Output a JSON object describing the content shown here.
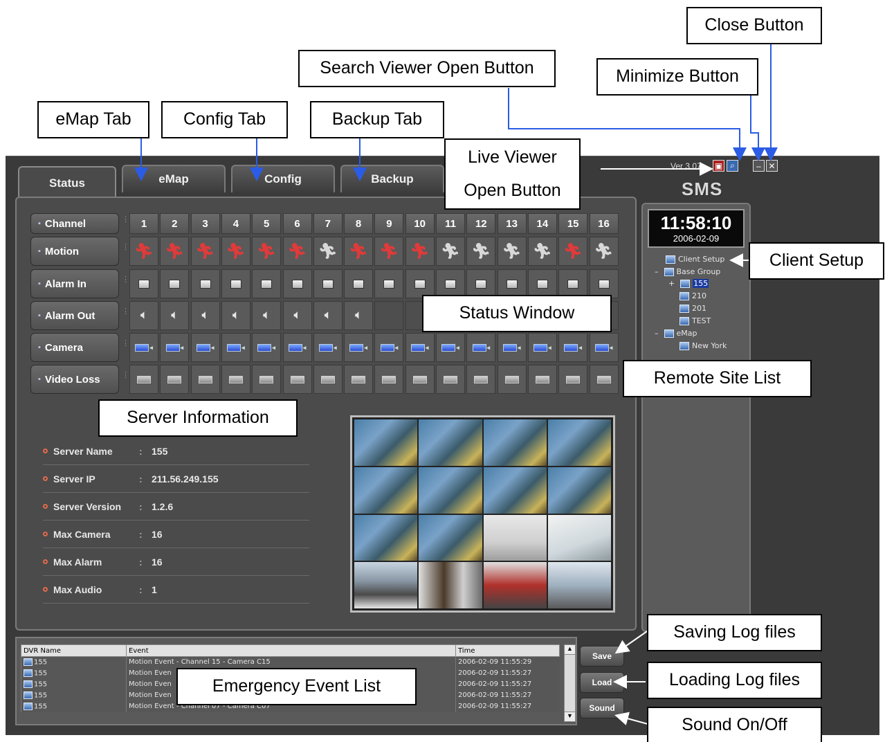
{
  "app": {
    "version": "Ver 3.07",
    "brand": "SMS",
    "clock_time": "11:58:10",
    "clock_date": "2006-02-09"
  },
  "tabs": [
    "Status",
    "eMap",
    "Config",
    "Backup"
  ],
  "status_grid": {
    "row_labels": [
      "Channel",
      "Motion",
      "Alarm In",
      "Alarm Out",
      "Camera",
      "Video Loss"
    ],
    "channels": [
      "1",
      "2",
      "3",
      "4",
      "5",
      "6",
      "7",
      "8",
      "9",
      "10",
      "11",
      "12",
      "13",
      "14",
      "15",
      "16"
    ],
    "motion_active": [
      true,
      true,
      true,
      true,
      true,
      true,
      false,
      true,
      true,
      true,
      false,
      false,
      false,
      false,
      true,
      false
    ],
    "alarm_out_count": 8
  },
  "server_info": [
    {
      "label": "Server Name",
      "value": "155"
    },
    {
      "label": "Server IP",
      "value": "211.56.249.155"
    },
    {
      "label": "Server Version",
      "value": "1.2.6"
    },
    {
      "label": "Max Camera",
      "value": "16"
    },
    {
      "label": "Max Alarm",
      "value": "16"
    },
    {
      "label": "Max Audio",
      "value": "1"
    }
  ],
  "tree": {
    "client_setup": "Client Setup",
    "base_group": "Base Group",
    "sites": [
      "155",
      "210",
      "201",
      "TEST"
    ],
    "emap": "eMap",
    "emap_child": "New York"
  },
  "event_list": {
    "headers": [
      "DVR Name",
      "Event",
      "Time"
    ],
    "rows": [
      {
        "dvr": "155",
        "event": "Motion Event  -  Channel 15  -  Camera C15",
        "time": "2006-02-09 11:55:29"
      },
      {
        "dvr": "155",
        "event": "Motion Even",
        "time": "2006-02-09 11:55:27"
      },
      {
        "dvr": "155",
        "event": "Motion Even",
        "time": "2006-02-09 11:55:27"
      },
      {
        "dvr": "155",
        "event": "Motion Even",
        "time": "2006-02-09 11:55:27"
      },
      {
        "dvr": "155",
        "event": "Motion Event  -  Channel 07  -  Camera C07",
        "time": "2006-02-09 11:55:27"
      }
    ]
  },
  "side_buttons": {
    "save": "Save",
    "load": "Load",
    "sound": "Sound"
  },
  "callouts": {
    "close": "Close Button",
    "search_viewer": "Search Viewer Open Button",
    "minimize": "Minimize Button",
    "emap_tab": "eMap Tab",
    "config_tab": "Config Tab",
    "backup_tab": "Backup Tab",
    "live_viewer_1": "Live Viewer",
    "live_viewer_2": "Open Button",
    "client_setup": "Client Setup",
    "status_window": "Status Window",
    "remote_site_list": "Remote Site List",
    "server_information": "Server Information",
    "saving_log": "Saving Log files",
    "loading_log": "Loading Log files",
    "sound_onoff": "Sound On/Off",
    "emergency_event_list": "Emergency Event List"
  },
  "colors": {
    "motion_active": "#e03a3a",
    "motion_idle": "#d8d8d8",
    "panel": "#4b4b4b",
    "accent": "#e36a4a"
  }
}
